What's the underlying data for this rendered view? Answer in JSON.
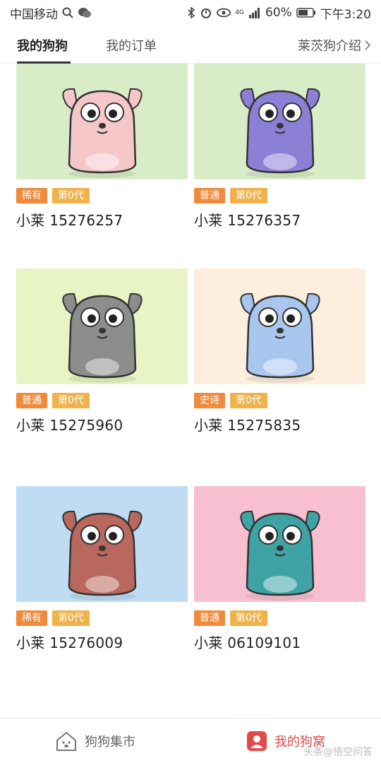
{
  "status_bar": {
    "carrier": "中国移动",
    "battery": "60%",
    "time": "下午3:20",
    "network": "4G"
  },
  "tabs": {
    "items": [
      {
        "label": "我的狗狗",
        "active": true
      },
      {
        "label": "我的订单",
        "active": false
      }
    ],
    "intro_link": "莱茨狗介绍"
  },
  "dogs": [
    {
      "rarity": "稀有",
      "generation": "第0代",
      "name": "小莱 15276257",
      "bg": "#d9ecc8",
      "body": "#f6c7c9"
    },
    {
      "rarity": "普通",
      "generation": "第0代",
      "name": "小莱 15276357",
      "bg": "#d9ecc8",
      "body": "#8b7fd6"
    },
    {
      "rarity": "普通",
      "generation": "第0代",
      "name": "小莱 15275960",
      "bg": "#e9f4c4",
      "body": "#8d8d8d"
    },
    {
      "rarity": "史诗",
      "generation": "第0代",
      "name": "小莱 15275835",
      "bg": "#fdeedd",
      "body": "#a9c6ef"
    },
    {
      "rarity": "稀有",
      "generation": "第0代",
      "name": "小莱 15276009",
      "bg": "#bfdcf3",
      "body": "#b8685c"
    },
    {
      "rarity": "普通",
      "generation": "第0代",
      "name": "小莱 06109101",
      "bg": "#f7bfcf",
      "body": "#3fa3a6"
    }
  ],
  "bottom_nav": {
    "market_label": "狗狗集市",
    "mine_label": "我的狗窝"
  },
  "watermark": "头条@悟空问答",
  "colors": {
    "rarity_badge": "#f08a3c",
    "generation_badge": "#f0b24a",
    "active_nav": "#e34a4a"
  }
}
